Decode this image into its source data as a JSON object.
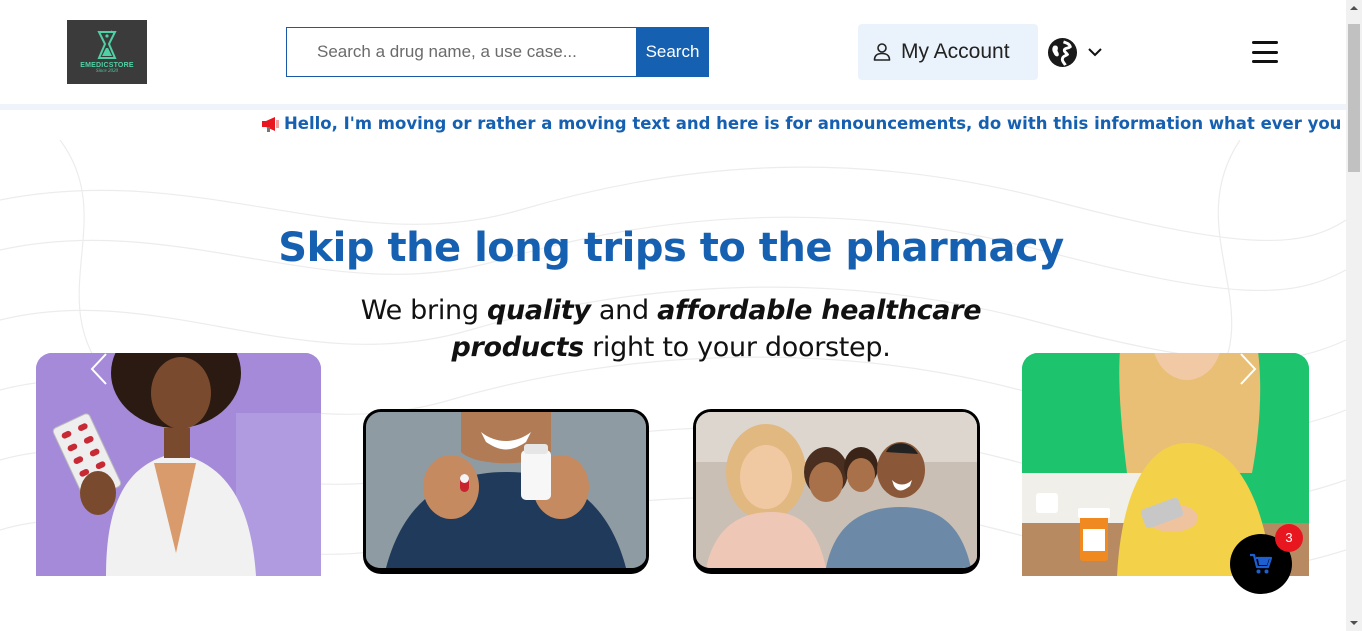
{
  "header": {
    "logo": {
      "name": "EMEDICSTORE",
      "since": "Since 2020"
    },
    "search": {
      "placeholder": "Search a drug name, a use case...",
      "value": "",
      "button_label": "Search"
    },
    "account": {
      "label": "My Account",
      "icon": "user-icon"
    },
    "language": {
      "icon": "globe-icon",
      "dropdown_icon": "chevron-down-icon"
    },
    "menu": {
      "icon": "hamburger-menu-icon"
    }
  },
  "announcement": {
    "text": "Hello, I'm moving or rather a moving text and here is for announcements, do with this information what ever you wish!!!",
    "leading_icon": "megaphone-icon",
    "trailing_icon": "sparkle-icon"
  },
  "hero": {
    "title": "Skip the long trips to the pharmacy",
    "subtitle": {
      "part1": "We bring ",
      "em1": "quality",
      "part2": " and ",
      "em2": "affordable healthcare",
      "em3": "products",
      "part3": " right to your doorstep."
    },
    "images": [
      {
        "name": "pharmacist-holding-pills"
      },
      {
        "name": "man-holding-pill-and-bottle"
      },
      {
        "name": "smiling-family"
      },
      {
        "name": "woman-with-phone-and-medicine"
      }
    ]
  },
  "carousel": {
    "prev_icon": "chevron-left-icon",
    "next_icon": "chevron-right-icon"
  },
  "cart": {
    "count": "3",
    "icon": "cart-icon"
  },
  "colors": {
    "brand_blue": "#1560b0",
    "badge_red": "#e8161f",
    "account_bg": "#eaf2fb"
  }
}
